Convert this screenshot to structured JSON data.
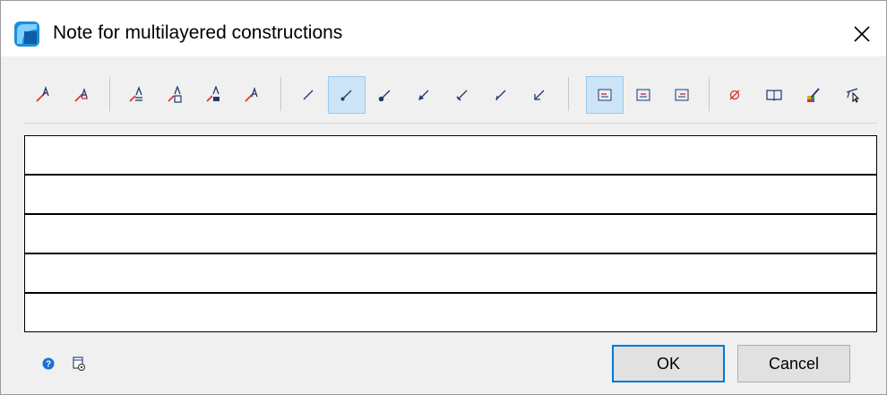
{
  "window": {
    "title": "Note for multilayered constructions",
    "app_icon": "app-logo-icon",
    "close_icon": "close-icon"
  },
  "toolbar": {
    "buttons": [
      {
        "name": "text-above-line-icon",
        "active": false
      },
      {
        "name": "text-on-line-icon",
        "active": false
      },
      {
        "name": "text-layer-align-1-icon",
        "active": false
      },
      {
        "name": "text-layer-align-2-icon",
        "active": false
      },
      {
        "name": "text-layer-align-3-icon",
        "active": false
      },
      {
        "name": "text-layer-align-4-icon",
        "active": false
      },
      {
        "name": "leader-no-arrow-icon",
        "active": false
      },
      {
        "name": "leader-dot-icon",
        "active": true
      },
      {
        "name": "leader-large-dot-icon",
        "active": false
      },
      {
        "name": "leader-filled-arrow-icon",
        "active": false
      },
      {
        "name": "leader-tick-icon",
        "active": false
      },
      {
        "name": "leader-slash-icon",
        "active": false
      },
      {
        "name": "leader-open-arrow-icon",
        "active": false
      },
      {
        "name": "frame-style-1-icon",
        "active": true
      },
      {
        "name": "frame-style-2-icon",
        "active": false
      },
      {
        "name": "frame-style-3-icon",
        "active": false
      },
      {
        "name": "diameter-symbol-icon",
        "active": false
      },
      {
        "name": "library-book-icon",
        "active": false
      },
      {
        "name": "color-pen-icon",
        "active": false
      },
      {
        "name": "pick-from-drawing-icon",
        "active": false
      }
    ]
  },
  "notes": {
    "rows": [
      "",
      "",
      "",
      "",
      ""
    ]
  },
  "footer": {
    "help_icon": "help-icon",
    "settings_icon": "settings-document-icon",
    "ok_label": "OK",
    "cancel_label": "Cancel"
  },
  "colors": {
    "accent_blue": "#0078d7",
    "active_bg": "#cce4f7",
    "icon_red": "#d9302c",
    "icon_navy": "#1f3a6e"
  }
}
